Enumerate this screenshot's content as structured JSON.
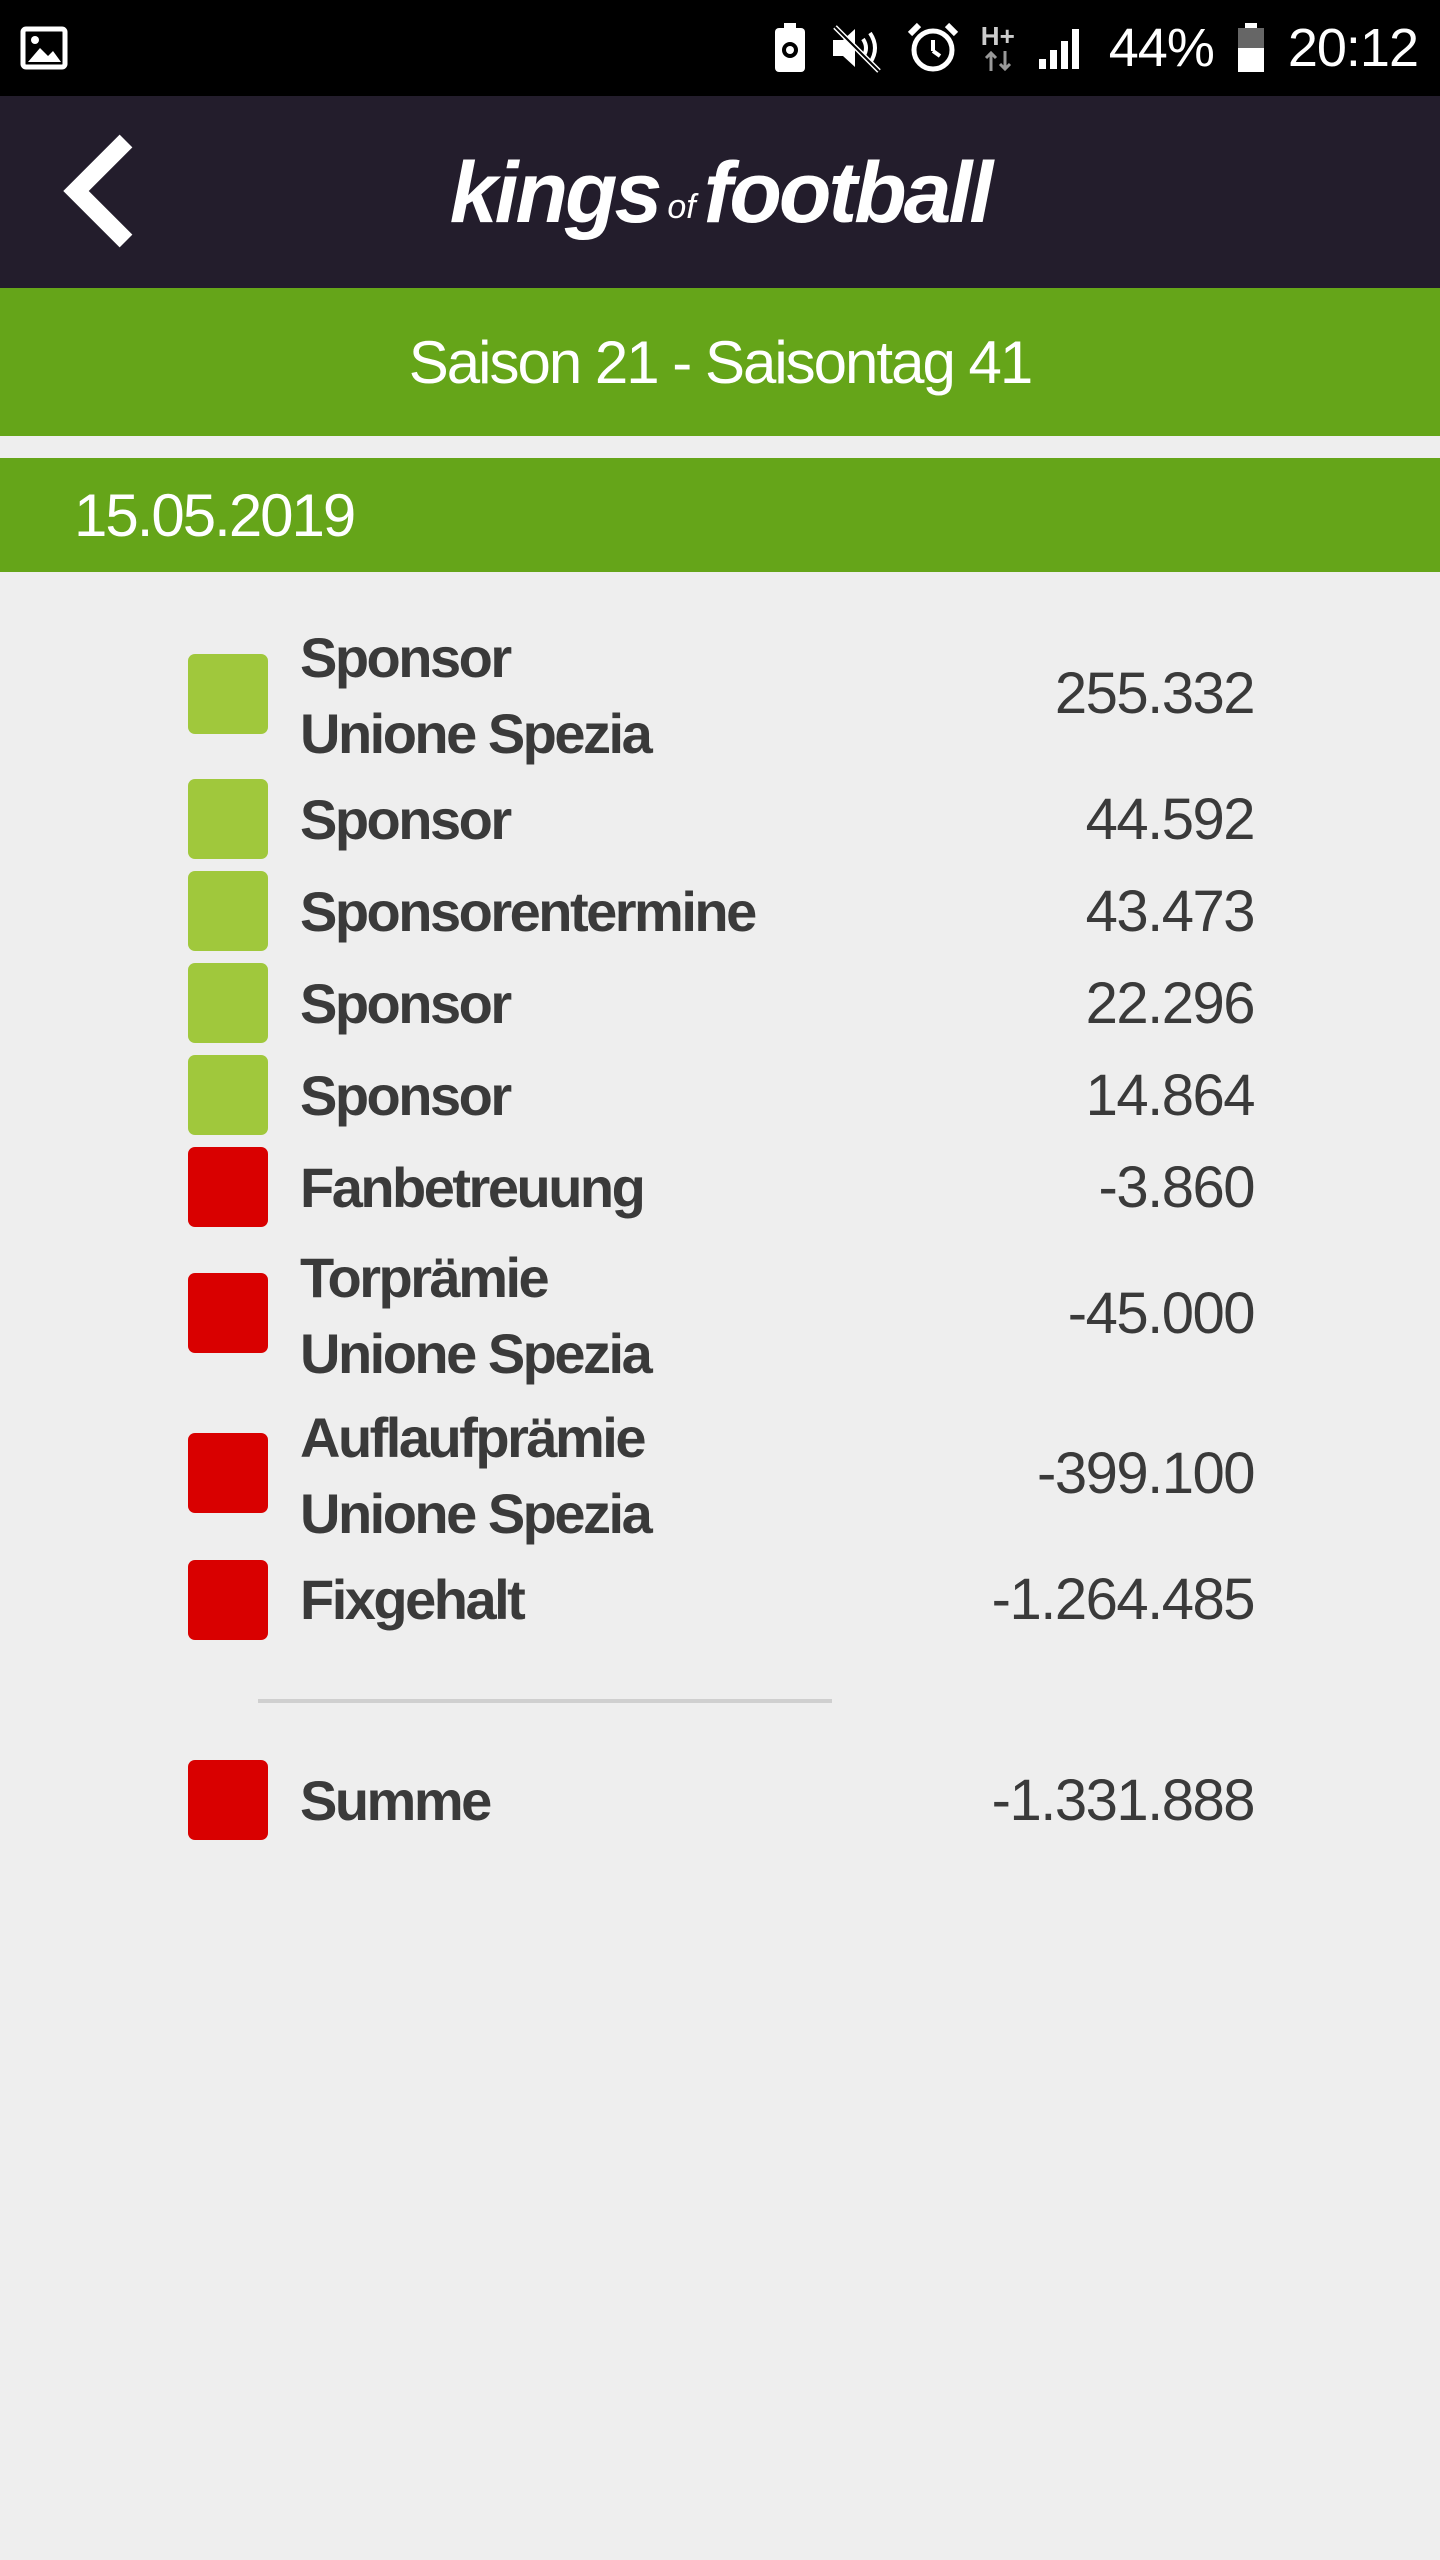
{
  "status_bar": {
    "battery_percent": "44%",
    "time": "20:12",
    "network_type": "H+",
    "icons": [
      "image-icon",
      "battery-saver-icon",
      "mute-icon",
      "alarm-icon",
      "data-arrows-icon",
      "signal-icon",
      "battery-icon"
    ]
  },
  "app_bar": {
    "logo_part1": "kings",
    "logo_part2": "of",
    "logo_part3": "football",
    "back_icon": "chevron-left-icon"
  },
  "season_header": "Saison 21 - Saisontag 41",
  "date": "15.05.2019",
  "colors": {
    "income": "#a0c83c",
    "expense": "#d90000",
    "header_green": "#65a519",
    "appbar": "#231d2c"
  },
  "entries": [
    {
      "line1": "Sponsor",
      "line2": "Unione Spezia",
      "amount": "255.332",
      "type": "income"
    },
    {
      "line1": "Sponsor",
      "line2": "",
      "amount": "44.592",
      "type": "income"
    },
    {
      "line1": "Sponsorentermine",
      "line2": "",
      "amount": "43.473",
      "type": "income"
    },
    {
      "line1": "Sponsor",
      "line2": "",
      "amount": "22.296",
      "type": "income"
    },
    {
      "line1": "Sponsor",
      "line2": "",
      "amount": "14.864",
      "type": "income"
    },
    {
      "line1": "Fanbetreuung",
      "line2": "",
      "amount": "-3.860",
      "type": "expense"
    },
    {
      "line1": "Torprämie",
      "line2": "Unione Spezia",
      "amount": "-45.000",
      "type": "expense"
    },
    {
      "line1": "Auflaufprämie",
      "line2": "Unione Spezia",
      "amount": "-399.100",
      "type": "expense"
    },
    {
      "line1": "Fixgehalt",
      "line2": "",
      "amount": "-1.264.485",
      "type": "expense"
    }
  ],
  "total": {
    "label": "Summe",
    "amount": "-1.331.888",
    "type": "expense"
  }
}
